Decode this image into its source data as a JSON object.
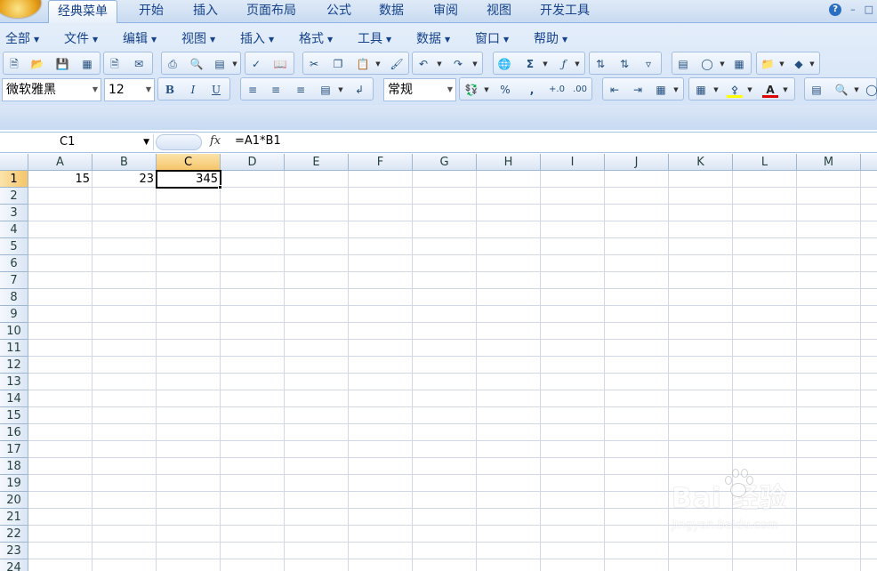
{
  "ribbon": {
    "tabs": [
      "经典菜单",
      "开始",
      "插入",
      "页面布局",
      "公式",
      "数据",
      "审阅",
      "视图",
      "开发工具"
    ],
    "active_tab": "经典菜单"
  },
  "menu": [
    "全部",
    "文件",
    "编辑",
    "视图",
    "插入",
    "格式",
    "工具",
    "数据",
    "窗口",
    "帮助"
  ],
  "font": {
    "name": "微软雅黑",
    "size": "12"
  },
  "number_format": "常规",
  "name_box": "C1",
  "formula": "=A1*B1",
  "fx_symbol": "fx",
  "columns": [
    "A",
    "B",
    "C",
    "D",
    "E",
    "F",
    "G",
    "H",
    "I",
    "J",
    "K",
    "L",
    "M"
  ],
  "rows": [
    "1",
    "2",
    "3",
    "4",
    "5",
    "6",
    "7",
    "8",
    "9",
    "10",
    "11",
    "12",
    "13",
    "14",
    "15",
    "16",
    "17",
    "18",
    "19",
    "20",
    "21",
    "22",
    "23",
    "24"
  ],
  "selected_column": "C",
  "selected_row": "1",
  "cells": {
    "A1": "15",
    "B1": "23",
    "C1": "345"
  },
  "watermark": {
    "main": "Bai 经验",
    "sub": "jingyan.baidu.com"
  },
  "colors": {
    "ribbon_bg": "#d0e0f4",
    "selected_header": "#f5c56a",
    "grid_line": "#d0d7e5"
  }
}
